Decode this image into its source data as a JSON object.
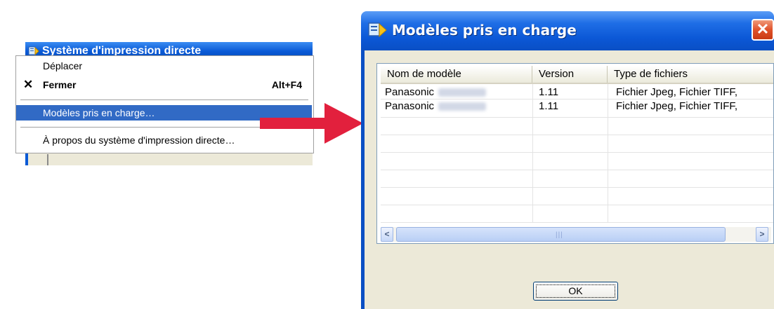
{
  "left_window": {
    "title": "Système d'impression directe"
  },
  "context_menu": {
    "items": [
      {
        "label": "Déplacer",
        "shortcut": ""
      },
      {
        "label": "Fermer",
        "shortcut": "Alt+F4"
      },
      {
        "label": "Modèles pris en charge…",
        "shortcut": ""
      },
      {
        "label": "À propos du système d'impression directe…",
        "shortcut": ""
      }
    ],
    "close_glyph": "✕"
  },
  "dialog": {
    "title": "Modèles pris en charge",
    "close_glyph": "✕",
    "columns": [
      "Nom de modèle",
      "Version",
      "Type de fichiers"
    ],
    "rows": [
      {
        "model": "Panasonic",
        "version": "1.11",
        "types": "Fichier Jpeg, Fichier TIFF,"
      },
      {
        "model": "Panasonic",
        "version": "1.11",
        "types": "Fichier Jpeg, Fichier TIFF,"
      }
    ],
    "scroll_left": "<",
    "scroll_right": ">",
    "ok_label": "OK"
  },
  "colors": {
    "title_blue": "#0a5ad6",
    "selection_blue": "#316ac5",
    "dialog_bg": "#ece9d8",
    "arrow_red": "#e2203d",
    "close_red": "#e0522a"
  },
  "icons": [
    "app-icon",
    "close-x-icon",
    "close-window-icon",
    "scroll-left-icon",
    "scroll-right-icon",
    "red-arrow"
  ]
}
